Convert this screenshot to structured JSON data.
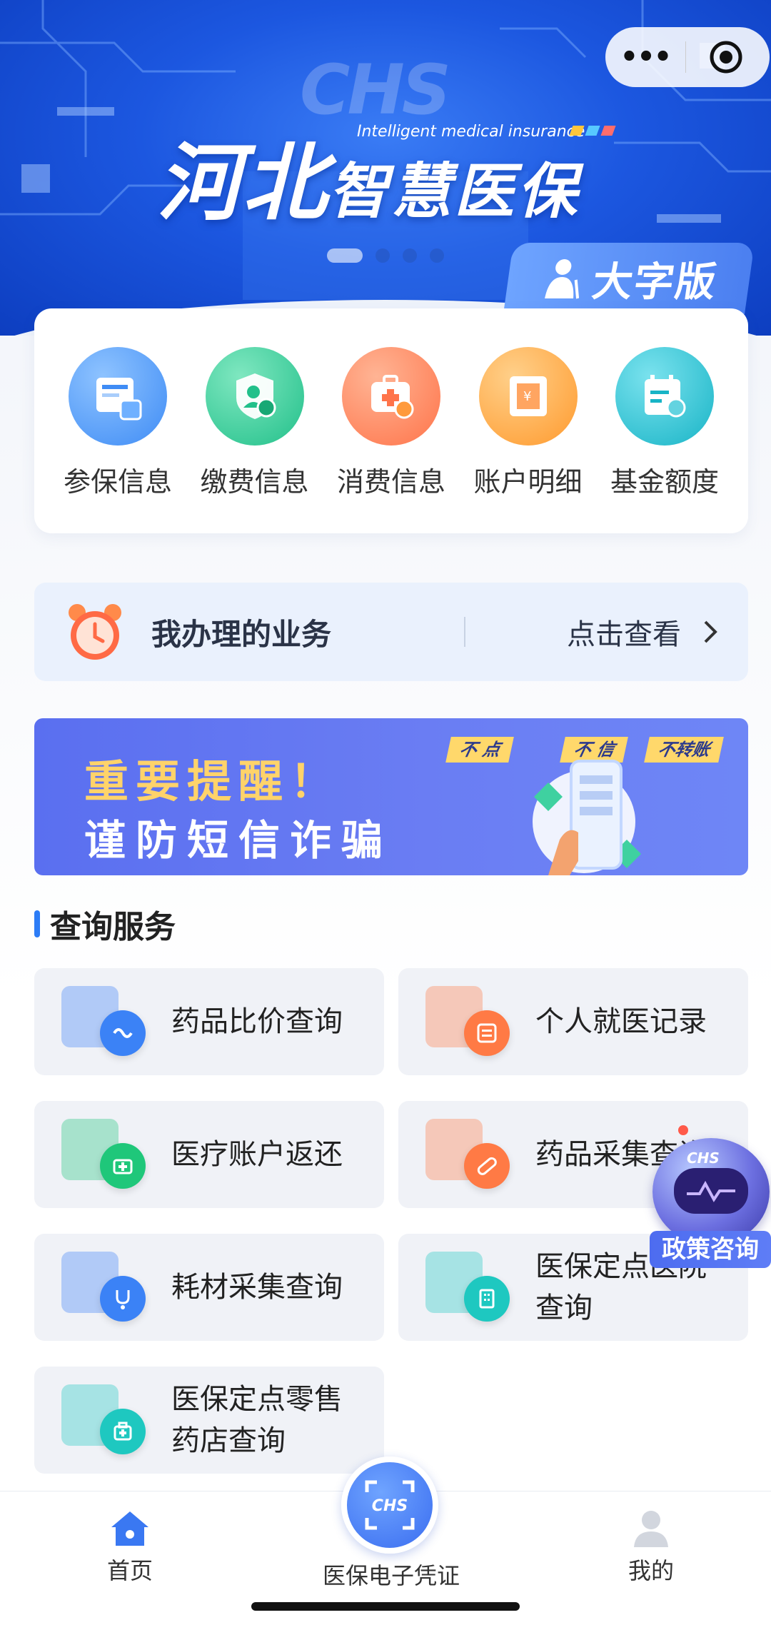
{
  "banner": {
    "title_main": "河北",
    "title_sub": "智慧医保",
    "subtitle_en": "Intelligent medical insurance",
    "watermark": "CHS",
    "slides": 4,
    "active_slide": 1,
    "large_font_label": "大字版"
  },
  "capsule": {
    "more": "•••"
  },
  "quick_actions": [
    {
      "label": "参保信息",
      "icon": "insurance-card-icon",
      "color": "#3f8cf5"
    },
    {
      "label": "缴费信息",
      "icon": "shield-user-icon",
      "color": "#25c58f"
    },
    {
      "label": "消费信息",
      "icon": "medical-kit-icon",
      "color": "#ff7a4d"
    },
    {
      "label": "账户明细",
      "icon": "receipt-icon",
      "color": "#ffa23a"
    },
    {
      "label": "基金额度",
      "icon": "calendar-chart-icon",
      "color": "#1fb8c8"
    }
  ],
  "business": {
    "title": "我办理的业务",
    "link": "点击查看"
  },
  "reminder": {
    "line1": "重要提醒！",
    "line2": "谨防短信诈骗",
    "tags": [
      "不 点",
      "不 信",
      "不转账"
    ]
  },
  "query_section": {
    "title": "查询服务",
    "items": [
      {
        "label": "药品比价查询",
        "icon": "drug-compare-icon",
        "color": "#3b82f6"
      },
      {
        "label": "个人就医记录",
        "icon": "medical-record-icon",
        "color": "#ff7a45"
      },
      {
        "label": "医疗账户返还",
        "icon": "account-return-icon",
        "color": "#1fc77a"
      },
      {
        "label": "药品采集查询",
        "icon": "pill-icon",
        "color": "#ff7a45"
      },
      {
        "label": "耗材采集查询",
        "icon": "stethoscope-icon",
        "color": "#3b82f6"
      },
      {
        "label": "医保定点医院查询",
        "icon": "hospital-icon",
        "color": "#1ec8c0"
      },
      {
        "label": "医保定点零售药店查询",
        "icon": "pharmacy-icon",
        "color": "#1ec8c0"
      }
    ]
  },
  "floating": {
    "logo": "CHS",
    "label": "政策咨询"
  },
  "tabbar": {
    "home": "首页",
    "center": "医保电子凭证",
    "center_logo": "CHS",
    "mine": "我的"
  }
}
